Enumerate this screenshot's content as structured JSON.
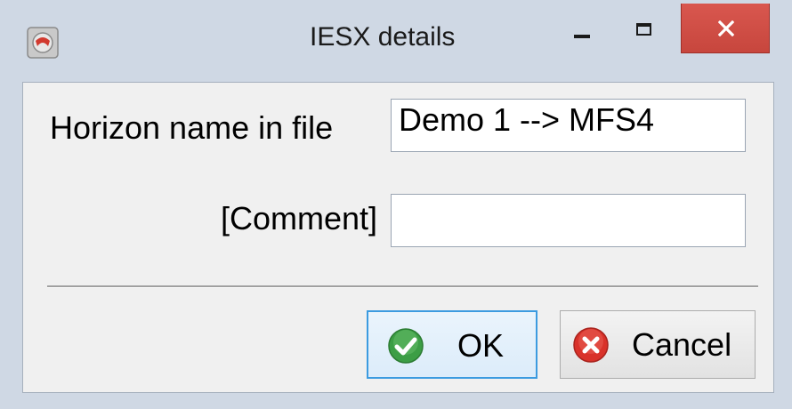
{
  "window": {
    "title": "IESX details",
    "app_icon": "app-icon",
    "controls": {
      "minimize_icon": "minimize-icon",
      "maximize_icon": "maximize-icon",
      "close_icon": "close-icon",
      "close_color": "#c7463d"
    }
  },
  "form": {
    "horizon_label": "Horizon name in file",
    "horizon_value": "Demo 1 --> MFS4",
    "comment_label": "[Comment]",
    "comment_value": ""
  },
  "buttons": {
    "ok_label": "OK",
    "ok_icon": "check-icon",
    "ok_color": "#3c9e45",
    "cancel_label": "Cancel",
    "cancel_icon": "cancel-x-icon",
    "cancel_color": "#d9322a"
  }
}
